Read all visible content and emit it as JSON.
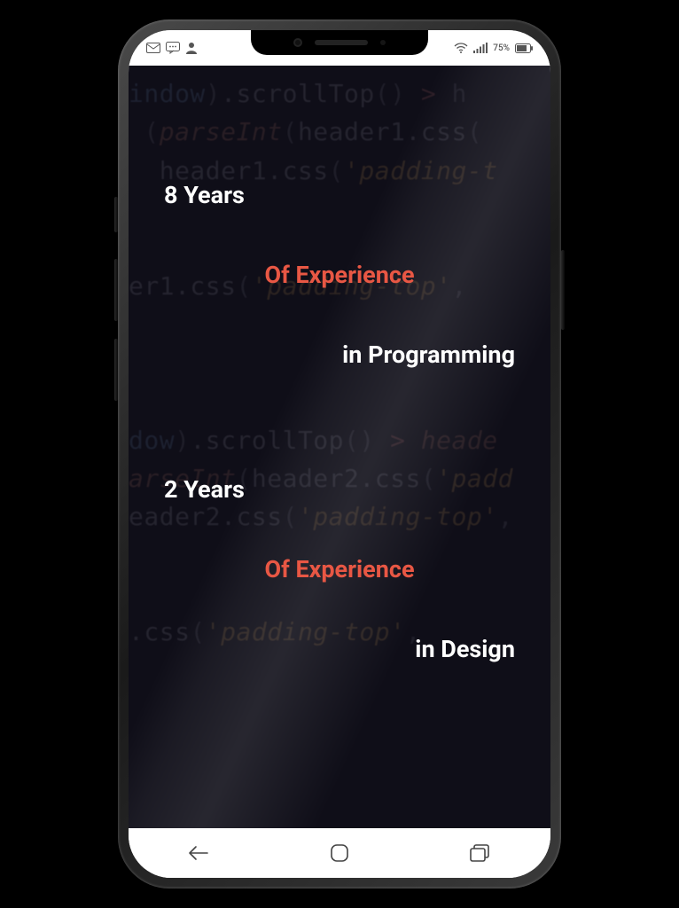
{
  "status": {
    "battery_text": "75%"
  },
  "blocks": [
    {
      "years": "8 Years",
      "exp": "Of Experience",
      "field": "in Programming"
    },
    {
      "years": "2 Years",
      "exp": "Of Experience",
      "field": "in Design"
    }
  ],
  "code_lines": [
    "indow).scrollTop() > h",
    "(parseInt(header1.css(",
    " header1.css('padding-t",
    "",
    "",
    "er1.css('padding-top',",
    "",
    "",
    "",
    "dow).scrollTop() > heade",
    "arseInt(header2.css('padd",
    "eader2.css('padding-top',",
    "",
    "",
    ".css('padding-top',"
  ]
}
